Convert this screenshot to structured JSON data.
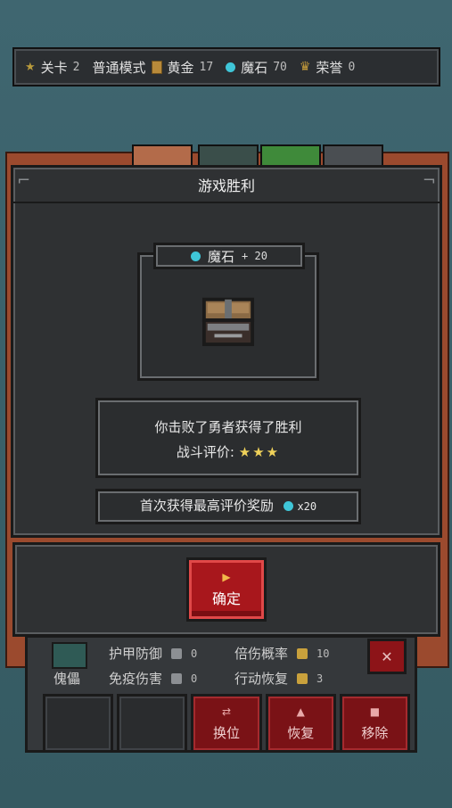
{
  "topbar": {
    "level_label": "关卡",
    "level_value": "2",
    "mode": "普通模式",
    "gold_label": "黄金",
    "gold_value": "17",
    "magicstone_label": "魔石",
    "magicstone_value": "70",
    "honor_label": "荣誉",
    "honor_value": "0"
  },
  "dialog": {
    "title": "游戏胜利",
    "reward": {
      "label": "魔石",
      "amount": "+ 20"
    },
    "message": "你击败了勇者获得了胜利",
    "rating_label": "战斗评价:",
    "rating_stars": "★★★",
    "bonus_text": "首次获得最高评价奖励",
    "bonus_amount": "x20",
    "confirm_label": "确定"
  },
  "stats": {
    "armor_label": "护甲防御",
    "armor_value": "0",
    "multiplier_label": "倍伤概率",
    "multiplier_value": "10",
    "immune_label": "免疫伤害",
    "immune_value": "0",
    "recover_label": "行动恢复",
    "recover_value": "3",
    "unit_name": "傀儡",
    "actions": [
      "换位",
      "恢复",
      "移除"
    ]
  },
  "colors": {
    "accent_red": "#a8171c",
    "gem": "#3fc6d8",
    "gold_star": "#f0d25a"
  }
}
